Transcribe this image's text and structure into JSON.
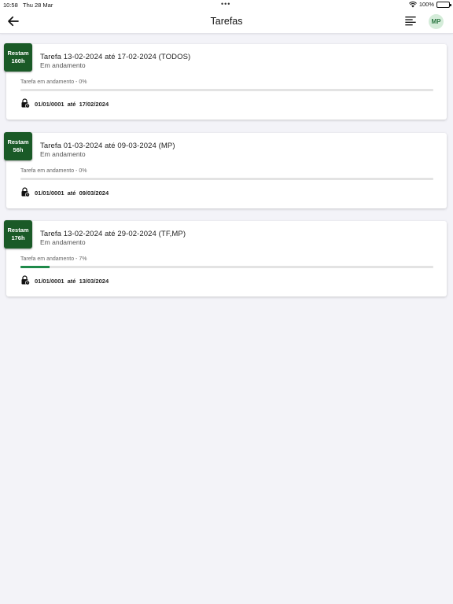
{
  "status_bar": {
    "time": "10:58",
    "date": "Thu 28 Mar",
    "battery": "100%"
  },
  "app_bar": {
    "title": "Tarefas",
    "avatar_initials": "MP",
    "back_icon": "arrow-left-icon",
    "menu_icon": "align-left-icon"
  },
  "colors": {
    "badge": "#1a5a27",
    "progress": "#1f8a4a",
    "avatar_bg": "#d4ecd9",
    "avatar_text": "#2f7a45"
  },
  "tasks": [
    {
      "badge_top": "Restam",
      "badge_bottom": "160h",
      "title": "Tarefa 13-02-2024 até 17-02-2024 (TODOS)",
      "status": "Em andamento",
      "progress_label": "Tarefa em andamento - 0%",
      "progress": 0,
      "start_date": "01/01/0001",
      "until": "até",
      "end_date": "17/02/2024"
    },
    {
      "badge_top": "Restam",
      "badge_bottom": "56h",
      "title": "Tarefa 01-03-2024 até 09-03-2024 (MP)",
      "status": "Em andamento",
      "progress_label": "Tarefa em andamento - 0%",
      "progress": 0,
      "start_date": "01/01/0001",
      "until": "até",
      "end_date": "09/03/2024"
    },
    {
      "badge_top": "Restam",
      "badge_bottom": "176h",
      "title": "Tarefa 13-02-2024 até 29-02-2024 (TF,MP)",
      "status": "Em andamento",
      "progress_label": "Tarefa em andamento - 7%",
      "progress": 7,
      "start_date": "01/01/0001",
      "until": "até",
      "end_date": "13/03/2024"
    }
  ]
}
